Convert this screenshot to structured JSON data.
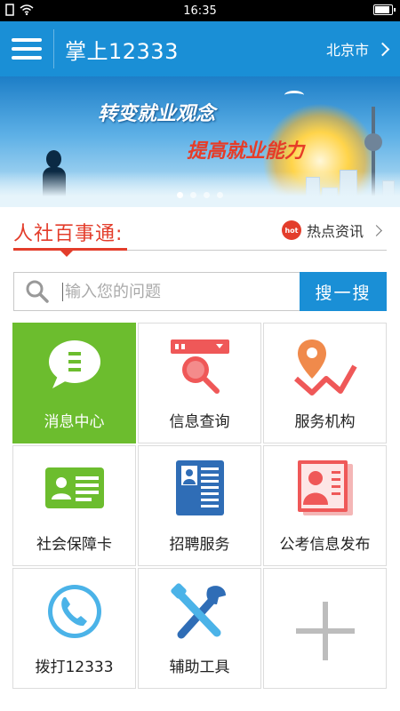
{
  "status_bar": {
    "time": "16:35"
  },
  "header": {
    "title": "掌上12333",
    "city": "北京市"
  },
  "banner": {
    "slogan_line1": "转变就业观念",
    "slogan_line2": "提高就业能力"
  },
  "section": {
    "title": "人社百事通:",
    "hot_badge": "hot",
    "hot_label": "热点资讯"
  },
  "search": {
    "placeholder": "输入您的问题",
    "button_label": "搜一搜"
  },
  "grid": {
    "items": [
      {
        "label": "消息中心",
        "icon": "message-icon",
        "active": true
      },
      {
        "label": "信息查询",
        "icon": "search-magnifier-icon",
        "active": false
      },
      {
        "label": "服务机构",
        "icon": "location-pin-icon",
        "active": false
      },
      {
        "label": "社会保障卡",
        "icon": "id-card-icon",
        "active": false
      },
      {
        "label": "招聘服务",
        "icon": "resume-icon",
        "active": false
      },
      {
        "label": "公考信息发布",
        "icon": "profile-document-icon",
        "active": false
      },
      {
        "label": "拨打12333",
        "icon": "phone-icon",
        "active": false
      },
      {
        "label": "辅助工具",
        "icon": "tools-icon",
        "active": false
      },
      {
        "label": "",
        "icon": "plus-icon",
        "active": false
      }
    ]
  },
  "colors": {
    "brand_blue": "#1a8fd6",
    "accent_red": "#e33d2b",
    "active_green": "#6cbd2e"
  }
}
